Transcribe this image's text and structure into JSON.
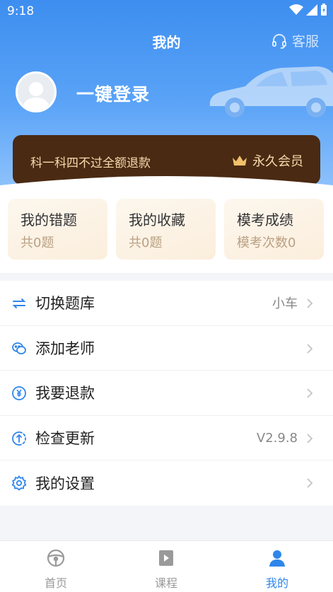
{
  "status": {
    "time": "9:18"
  },
  "nav": {
    "title": "我的",
    "service_label": "客服"
  },
  "profile": {
    "login_label": "一键登录"
  },
  "vip": {
    "promo_text": "科一科四不过全额退款",
    "badge_label": "永久会员"
  },
  "stats": [
    {
      "title": "我的错题",
      "sub": "共0题"
    },
    {
      "title": "我的收藏",
      "sub": "共0题"
    },
    {
      "title": "模考成绩",
      "sub": "模考次数0"
    }
  ],
  "menu": [
    {
      "label": "切换题库",
      "value": "小车",
      "icon": "switch-icon"
    },
    {
      "label": "添加老师",
      "value": "",
      "icon": "wechat-icon"
    },
    {
      "label": "我要退款",
      "value": "",
      "icon": "refund-icon"
    },
    {
      "label": "检查更新",
      "value": "V2.9.8",
      "icon": "update-icon"
    },
    {
      "label": "我的设置",
      "value": "",
      "icon": "settings-icon"
    }
  ],
  "tabs": [
    {
      "label": "首页",
      "icon": "steering-wheel-icon",
      "active": false
    },
    {
      "label": "课程",
      "icon": "course-icon",
      "active": false
    },
    {
      "label": "我的",
      "icon": "user-icon",
      "active": true
    }
  ],
  "colors": {
    "primary": "#3d8ef0",
    "vip_bg": "#4a2a12",
    "vip_text": "#f6dcae",
    "tab_active": "#2f86ea",
    "tab_inactive": "#9a9a9a"
  }
}
